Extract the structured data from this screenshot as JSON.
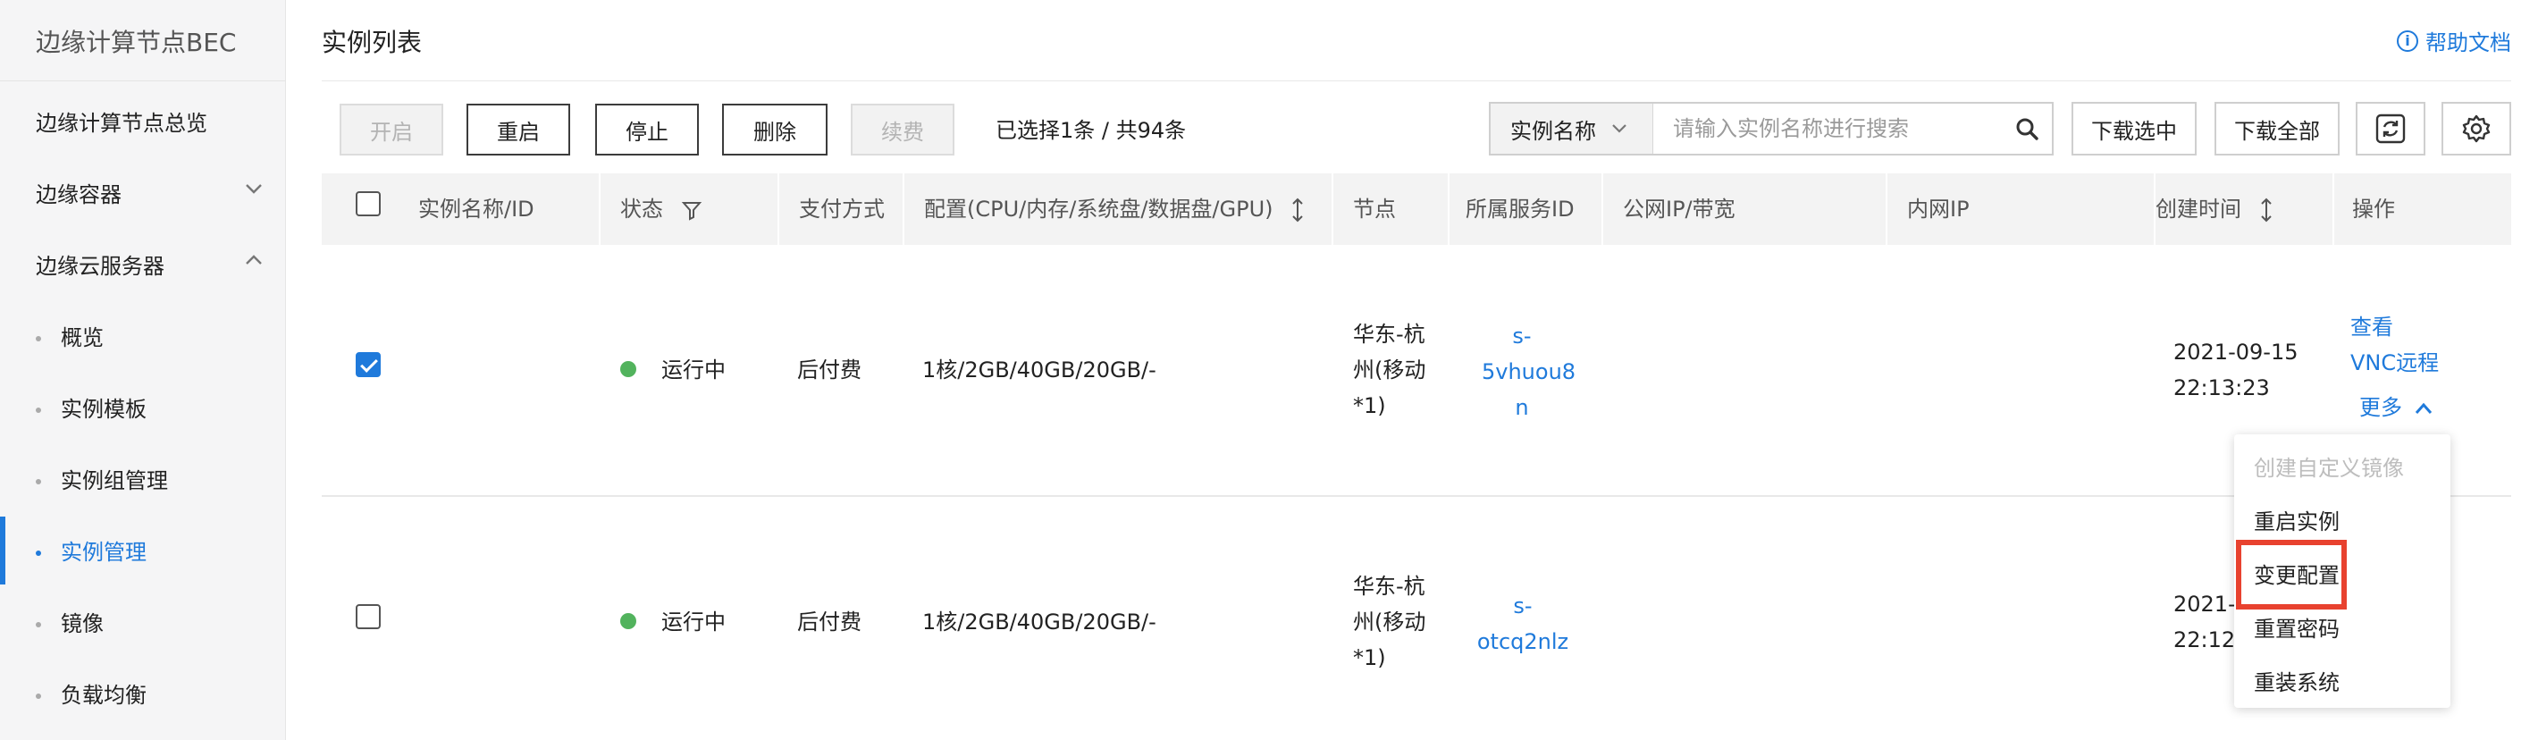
{
  "sidebar": {
    "title": "边缘计算节点BEC",
    "items": [
      {
        "label": "边缘计算节点总览"
      },
      {
        "label": "边缘容器"
      },
      {
        "label": "边缘云服务器"
      }
    ],
    "subitems": [
      {
        "label": "概览"
      },
      {
        "label": "实例模板"
      },
      {
        "label": "实例组管理"
      },
      {
        "label": "实例管理",
        "active": true
      },
      {
        "label": "镜像"
      },
      {
        "label": "负载均衡"
      }
    ]
  },
  "header": {
    "title": "实例列表",
    "help": "帮助文档"
  },
  "toolbar": {
    "start": "开启",
    "restart": "重启",
    "stop": "停止",
    "delete": "删除",
    "renew": "续费",
    "selection_info": "已选择1条 / 共94条",
    "search_field": "实例名称",
    "search_placeholder": "请输入实例名称进行搜索",
    "download_selected": "下载选中",
    "download_all": "下载全部"
  },
  "table": {
    "columns": [
      "实例名称/ID",
      "状态",
      "支付方式",
      "配置(CPU/内存/系统盘/数据盘/GPU)",
      "节点",
      "所属服务ID",
      "公网IP/带宽",
      "内网IP",
      "创建时间",
      "操作"
    ],
    "rows": [
      {
        "checked": true,
        "status": "运行中",
        "payment": "后付费",
        "config": "1核/2GB/40GB/20GB/-",
        "node_lines": [
          "华东-杭",
          "州(移动",
          "*1)"
        ],
        "service_lines": [
          "s-",
          "5vhuou8",
          "n"
        ],
        "created_lines": [
          "2021-09-15",
          "22:13:23"
        ],
        "actions": [
          "查看",
          "VNC远程",
          "更多"
        ]
      },
      {
        "checked": false,
        "status": "运行中",
        "payment": "后付费",
        "config": "1核/2GB/40GB/20GB/-",
        "node_lines": [
          "华东-杭",
          "州(移动",
          "*1)"
        ],
        "service_lines": [
          "s-",
          "otcq2nlz"
        ],
        "created_lines": [
          "2021-",
          "22:12:"
        ]
      }
    ]
  },
  "dropdown": {
    "items": [
      {
        "label": "创建自定义镜像",
        "disabled": true
      },
      {
        "label": "重启实例"
      },
      {
        "label": "变更配置",
        "highlighted": true
      },
      {
        "label": "重置密码"
      },
      {
        "label": "重装系统"
      }
    ]
  },
  "colors": {
    "accent": "#1f7adb",
    "running": "#52b35d",
    "highlight": "#e8422f"
  }
}
